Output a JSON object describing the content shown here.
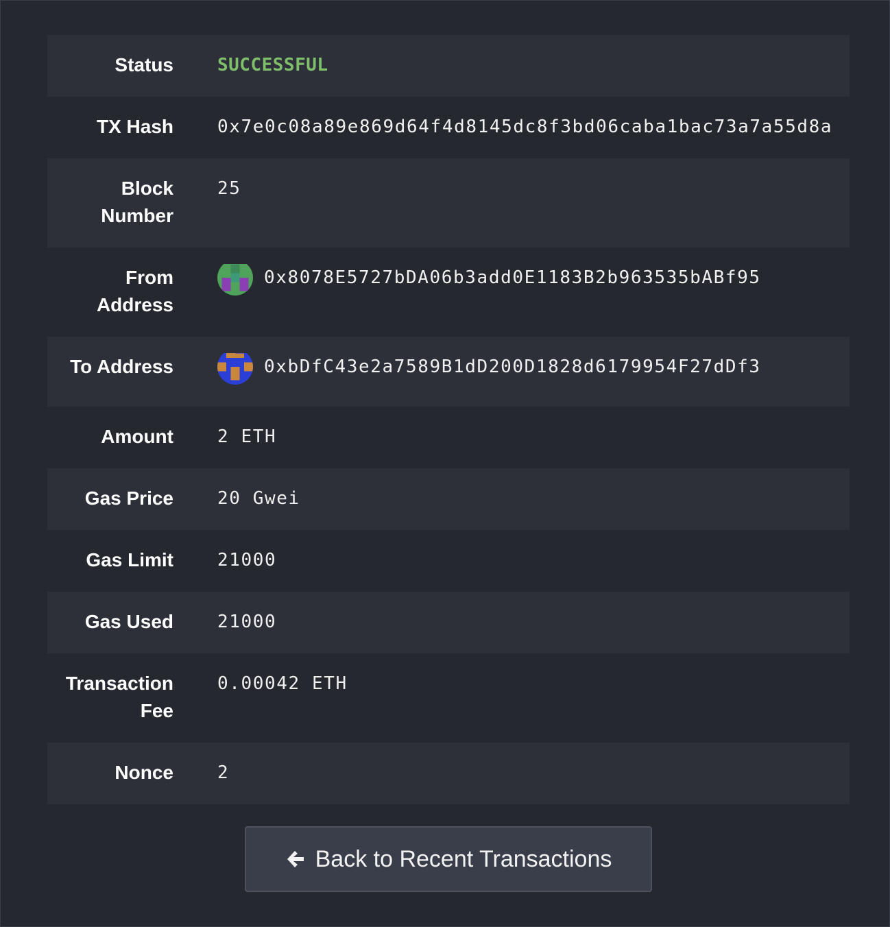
{
  "status": {
    "label": "Status",
    "value": "SUCCESSFUL",
    "color": "#7fbf6b"
  },
  "tx_hash": {
    "label": "TX Hash",
    "value": "0x7e0c08a89e869d64f4d8145dc8f3bd06caba1bac73a7a55d8a"
  },
  "block_number": {
    "label": "Block Number",
    "value": "25"
  },
  "from_address": {
    "label": "From Address",
    "value": "0x8078E5727bDA06b3add0E1183B2b963535bABf95",
    "avatar_colors": [
      "#4fa35a",
      "#8a3fb3"
    ]
  },
  "to_address": {
    "label": "To Address",
    "value": "0xbDfC43e2a7589B1dD200D1828d6179954F27dDf3",
    "avatar_colors": [
      "#2b3fd6",
      "#c8873c"
    ]
  },
  "amount": {
    "label": "Amount",
    "value": "2 ETH"
  },
  "gas_price": {
    "label": "Gas Price",
    "value": "20 Gwei"
  },
  "gas_limit": {
    "label": "Gas Limit",
    "value": "21000"
  },
  "gas_used": {
    "label": "Gas Used",
    "value": "21000"
  },
  "transaction_fee": {
    "label": "Transaction Fee",
    "value": "0.00042 ETH"
  },
  "nonce": {
    "label": "Nonce",
    "value": "2"
  },
  "back_button": {
    "label": "Back to Recent Transactions",
    "icon": "arrow-left-icon"
  }
}
